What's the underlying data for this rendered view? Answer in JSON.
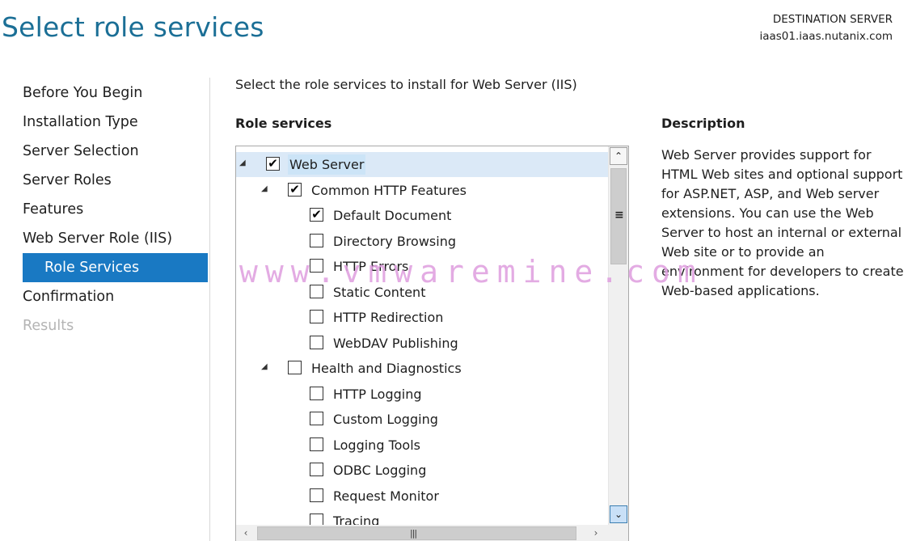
{
  "page": {
    "title": "Select role services",
    "destination_label": "DESTINATION SERVER",
    "destination_server": "iaas01.iaas.nutanix.com"
  },
  "nav": {
    "items": [
      {
        "label": "Before You Begin",
        "state": "normal"
      },
      {
        "label": "Installation Type",
        "state": "normal"
      },
      {
        "label": "Server Selection",
        "state": "normal"
      },
      {
        "label": "Server Roles",
        "state": "normal"
      },
      {
        "label": "Features",
        "state": "normal"
      },
      {
        "label": "Web Server Role (IIS)",
        "state": "normal"
      },
      {
        "label": "Role Services",
        "state": "active"
      },
      {
        "label": "Confirmation",
        "state": "normal"
      },
      {
        "label": "Results",
        "state": "disabled"
      }
    ]
  },
  "main": {
    "instruction": "Select the role services to install for Web Server (IIS)",
    "role_services_heading": "Role services",
    "description_heading": "Description",
    "description": "Web Server provides support for HTML Web sites and optional support for ASP.NET, ASP, and Web server extensions. You can use the Web Server to host an internal or external Web site or to provide an environment for developers to create Web-based applications."
  },
  "tree": {
    "items": [
      {
        "label": "Web Server",
        "level": 0,
        "checked": true,
        "expandable": true,
        "selected": true
      },
      {
        "label": "Common HTTP Features",
        "level": 1,
        "checked": true,
        "expandable": true
      },
      {
        "label": "Default Document",
        "level": 2,
        "checked": true
      },
      {
        "label": "Directory Browsing",
        "level": 2,
        "checked": false
      },
      {
        "label": "HTTP Errors",
        "level": 2,
        "checked": false
      },
      {
        "label": "Static Content",
        "level": 2,
        "checked": false
      },
      {
        "label": "HTTP Redirection",
        "level": 2,
        "checked": false
      },
      {
        "label": "WebDAV Publishing",
        "level": 2,
        "checked": false
      },
      {
        "label": "Health and Diagnostics",
        "level": 1,
        "checked": false,
        "expandable": true
      },
      {
        "label": "HTTP Logging",
        "level": 2,
        "checked": false
      },
      {
        "label": "Custom Logging",
        "level": 2,
        "checked": false
      },
      {
        "label": "Logging Tools",
        "level": 2,
        "checked": false
      },
      {
        "label": "ODBC Logging",
        "level": 2,
        "checked": false
      },
      {
        "label": "Request Monitor",
        "level": 2,
        "checked": false
      },
      {
        "label": "Tracing",
        "level": 2,
        "checked": false
      }
    ]
  },
  "icons": {
    "expand": "expanded-triangle-icon",
    "check": "checkmark-icon",
    "scroll_up": "chevron-up-icon",
    "scroll_down": "chevron-down-icon",
    "scroll_left": "chevron-left-icon",
    "scroll_right": "chevron-right-icon"
  },
  "watermark": "www.vmwaremine.com",
  "colors": {
    "title": "#1b6f96",
    "nav_active_bg": "#1979c3",
    "selection": "#cce4f7",
    "watermark": "#e0a3e0"
  }
}
